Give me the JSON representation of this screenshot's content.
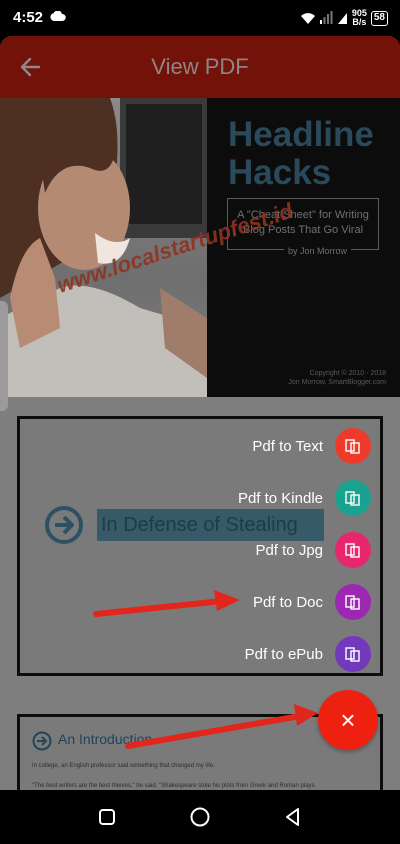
{
  "status_bar": {
    "time": "4:52",
    "net_speed_value": "905",
    "net_speed_unit": "B/s",
    "battery": "58"
  },
  "app_bar": {
    "title": "View PDF"
  },
  "pdf": {
    "cover": {
      "title_line1": "Headline",
      "title_line2": "Hacks",
      "subtitle": "A \"Cheat Sheet\" for Writing Blog Posts That Go Viral",
      "byline": "by Jon Morrow",
      "copyright_line1": "Copyright © 2010 - 2018",
      "copyright_line2": "Jon Morrow, SmartBlogger.com",
      "watermark": "www.localstartupfest.id"
    },
    "page2": {
      "heading": "In Defense of Stealing"
    },
    "page3": {
      "heading": "An Introduction",
      "para1": "In college, an English professor said something that changed my life.",
      "para2": "\"The best writers are the best thieves,\" he said. \"Shakespeare stole his plots from Greek and Roman plays."
    }
  },
  "speed_dial": {
    "items": [
      {
        "label": "Pdf to Text",
        "color": "#ee3a2b",
        "icon": "file-text-icon"
      },
      {
        "label": "Pdf to Kindle",
        "color": "#19a28f",
        "icon": "file-kindle-icon"
      },
      {
        "label": "Pdf to Jpg",
        "color": "#e8266d",
        "icon": "file-image-icon"
      },
      {
        "label": "Pdf to Doc",
        "color": "#9c27b0",
        "icon": "file-doc-icon"
      },
      {
        "label": "Pdf to ePub",
        "color": "#7339bd",
        "icon": "file-epub-icon"
      }
    ],
    "close_label": "×",
    "fab_color": "#ee2111"
  },
  "colors": {
    "app_bar": "#721208",
    "annotation_arrow": "#e2261b"
  }
}
